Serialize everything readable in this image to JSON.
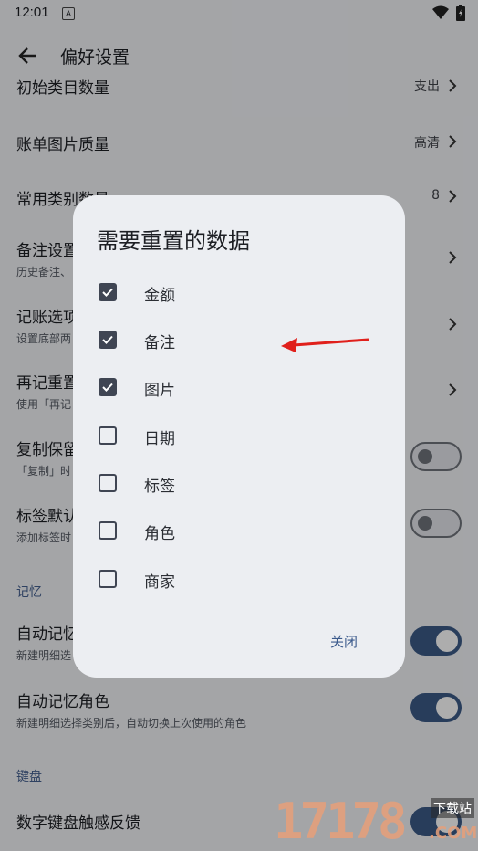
{
  "status_bar": {
    "time": "12:01",
    "notification_badge": "A"
  },
  "app_bar": {
    "title": "偏好设置"
  },
  "settings": {
    "partial_row": {
      "title": "初始类目数量",
      "value": "支出"
    },
    "bill_image_quality": {
      "title": "账单图片质量",
      "value": "高清"
    },
    "frequent_category_count": {
      "title": "常用类别数量",
      "value": "8"
    },
    "note_settings": {
      "title": "备注设置",
      "subtitle": "历史备注、"
    },
    "bookkeeping_options": {
      "title": "记账选项",
      "subtitle": "设置底部两"
    },
    "record_again_reset": {
      "title": "再记重置",
      "subtitle": "使用「再记"
    },
    "copy_keep": {
      "title": "复制保留",
      "subtitle": "「复制」时",
      "enabled": false
    },
    "tag_default": {
      "title": "标签默认",
      "subtitle": "添加标签时",
      "enabled": false
    },
    "memory_section": "记忆",
    "auto_memory": {
      "title": "自动记忆",
      "subtitle": "新建明细选",
      "enabled": true
    },
    "auto_memory_role": {
      "title": "自动记忆角色",
      "subtitle": "新建明细选择类别后，自动切换上次使用的角色",
      "enabled": true
    },
    "keyboard_section": "键盘",
    "keypad_haptic": {
      "title": "数字键盘触感反馈"
    }
  },
  "dialog": {
    "title": "需要重置的数据",
    "options": [
      {
        "label": "金额",
        "checked": true
      },
      {
        "label": "备注",
        "checked": true
      },
      {
        "label": "图片",
        "checked": true
      },
      {
        "label": "日期",
        "checked": false
      },
      {
        "label": "标签",
        "checked": false
      },
      {
        "label": "角色",
        "checked": false
      },
      {
        "label": "商家",
        "checked": false
      }
    ],
    "close_label": "关闭"
  },
  "annotation": {
    "arrow_color": "#e0201c"
  },
  "watermark": {
    "digits": "17178",
    "site": "下载站",
    "domain": ".COM"
  },
  "colors": {
    "accent": "#3b5a86",
    "background": "#f2f3f7",
    "dialog": "#eceef2"
  }
}
